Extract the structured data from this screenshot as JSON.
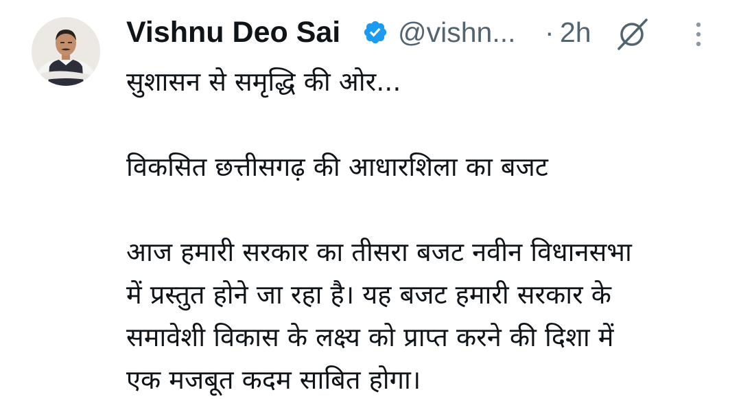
{
  "author": {
    "name": "Vishnu Deo Sai",
    "handle": "@vishn...",
    "separator": "·",
    "time": "2h",
    "verified": true
  },
  "icons": {
    "avatar": "profile-photo",
    "verified": "verified-badge-icon",
    "grok": "grok-icon",
    "more": "more-vertical-icon"
  },
  "colors": {
    "text": "#0f1419",
    "secondary": "#536471",
    "verified": "#1d9bf0"
  },
  "tweet": {
    "line1": "सुशासन से समृद्धि की ओर...",
    "line2": "विकसित छत्तीसगढ़ की आधारशिला का बजट",
    "line3": "आज हमारी सरकार का तीसरा बजट नवीन विधानसभा",
    "line4": "में प्रस्तुत होने जा रहा है। यह बजट हमारी सरकार के",
    "line5": "समावेशी विकास के लक्ष्य को प्राप्त करने की दिशा में",
    "line6": "एक मजबूत कदम साबित होगा।"
  }
}
